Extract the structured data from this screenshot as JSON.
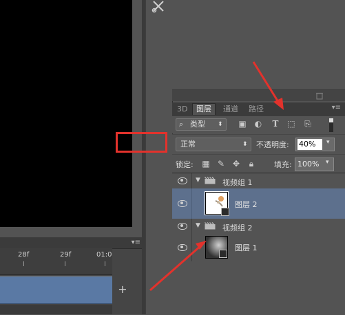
{
  "timeline": {
    "ticks": [
      "28f",
      "29f",
      "01:0"
    ],
    "menu_glyph": "▾≡",
    "add_track": "+"
  },
  "upper_panel": {
    "trash_icon": "trash-icon"
  },
  "layers_panel": {
    "tabs": [
      "3D",
      "图层",
      "通道",
      "路径"
    ],
    "active_tab": "图层",
    "menu_glyph": "▾≡",
    "filter": {
      "kind_label": "类型",
      "icons": [
        "image-filter-icon",
        "adjustment-filter-icon",
        "type-filter-icon",
        "shape-filter-icon",
        "smartobject-filter-icon"
      ]
    },
    "blend_mode": "正常",
    "opacity_label": "不透明度:",
    "opacity_value": "40%",
    "lock_label": "锁定:",
    "fill_label": "填充:",
    "fill_value": "100%",
    "layers": [
      {
        "type": "group",
        "name": "视频组 1",
        "expanded": true
      },
      {
        "type": "layer",
        "name": "图层 2",
        "selected": true
      },
      {
        "type": "group",
        "name": "视频组 2",
        "expanded": true
      },
      {
        "type": "layer",
        "name": "图层 1",
        "selected": false
      }
    ]
  },
  "colors": {
    "highlight_red": "#e3322c",
    "selected_row": "#5d708d",
    "track_blue": "#5a79a4"
  }
}
